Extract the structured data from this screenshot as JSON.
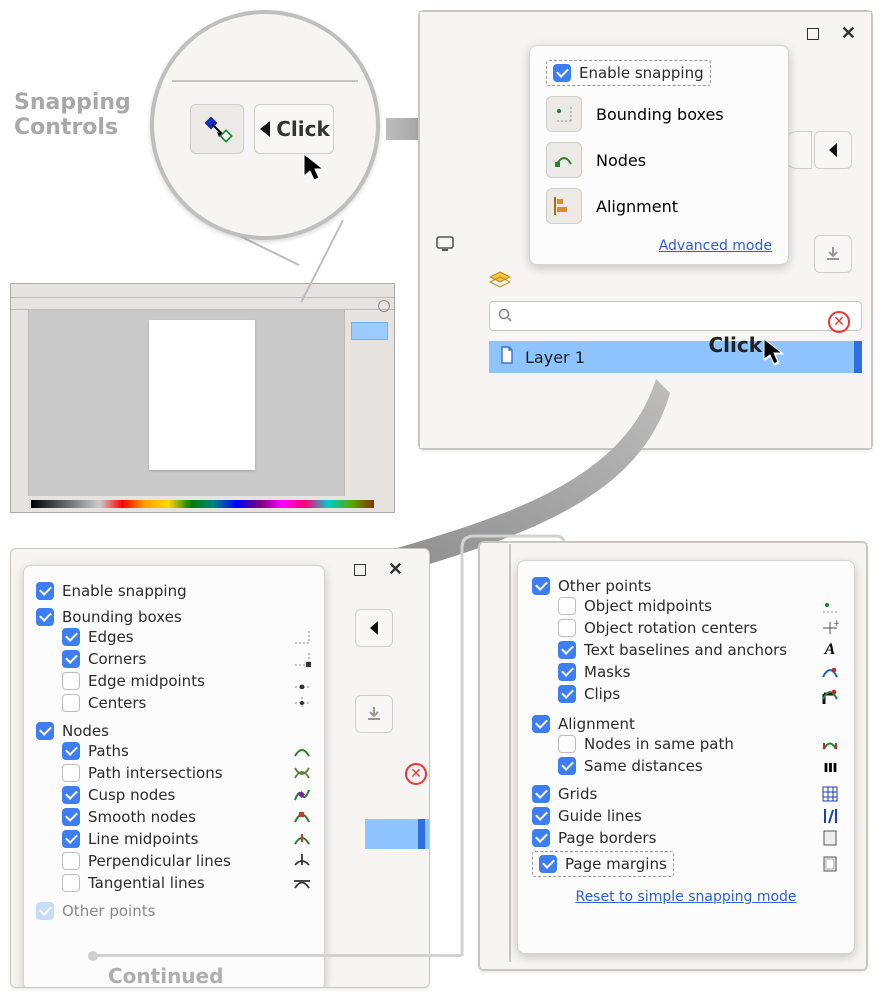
{
  "title_line1": "Snapping",
  "title_line2": "Controls",
  "zoom": {
    "click": "Click"
  },
  "simple": {
    "enable": "Enable snapping",
    "bounding": "Bounding boxes",
    "nodes": "Nodes",
    "alignment": "Alignment",
    "advanced": "Advanced mode",
    "click": "Click",
    "layer": "Layer 1"
  },
  "adv1": {
    "enable": "Enable snapping",
    "bounding": "Bounding boxes",
    "edges": "Edges",
    "corners": "Corners",
    "edgemid": "Edge midpoints",
    "centers": "Centers",
    "nodes": "Nodes",
    "paths": "Paths",
    "pathint": "Path intersections",
    "cusp": "Cusp nodes",
    "smooth": "Smooth nodes",
    "linemid": "Line midpoints",
    "perp": "Perpendicular lines",
    "tang": "Tangential lines",
    "other": "Other points"
  },
  "continued": "Continued",
  "adv2": {
    "other": "Other points",
    "objmid": "Object midpoints",
    "objrot": "Object rotation centers",
    "textbase": "Text baselines and anchors",
    "masks": "Masks",
    "clips": "Clips",
    "alignment": "Alignment",
    "samepath": "Nodes in same path",
    "samedist": "Same distances",
    "grids": "Grids",
    "guides": "Guide lines",
    "pborders": "Page borders",
    "pmargins": "Page margins",
    "reset": "Reset to simple snapping mode"
  }
}
